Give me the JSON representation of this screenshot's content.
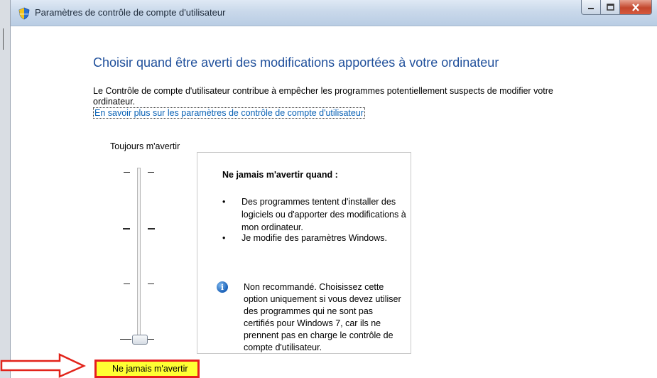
{
  "window": {
    "title": "Paramètres de contrôle de compte d'utilisateur"
  },
  "icons": {
    "app": "shield-icon",
    "minimize": "minimize-icon",
    "maximize": "maximize-icon",
    "close": "close-icon",
    "info": "info-icon",
    "arrow": "red-arrow-icon"
  },
  "main": {
    "heading": "Choisir quand être averti des modifications apportées à votre ordinateur",
    "description": "Le Contrôle de compte d'utilisateur contribue à empêcher les programmes potentiellement suspects de modifier votre ordinateur.",
    "link": "En savoir plus sur les paramètres de contrôle de compte d'utilisateur"
  },
  "slider": {
    "top_label": "Toujours m'avertir",
    "bottom_label": "Ne jamais m'avertir",
    "levels": 4,
    "selected_level": 1
  },
  "panel": {
    "title": "Ne jamais m'avertir quand :",
    "bullets": [
      "Des programmes tentent d'installer des logiciels ou d'apporter des modifications à mon ordinateur.",
      "Je modifie des paramètres Windows."
    ],
    "info_glyph": "i",
    "warning": "Non recommandé. Choisissez cette option uniquement si vous devez utiliser des programmes qui ne sont pas certifiés pour Windows 7, car ils ne prennent pas en charge le contrôle de compte d'utilisateur."
  },
  "colors": {
    "heading": "#1f4f9b",
    "link": "#0a62b5",
    "highlight_fill": "#ffff33",
    "highlight_border": "#e61e1e",
    "close_button": "#c3472d"
  }
}
